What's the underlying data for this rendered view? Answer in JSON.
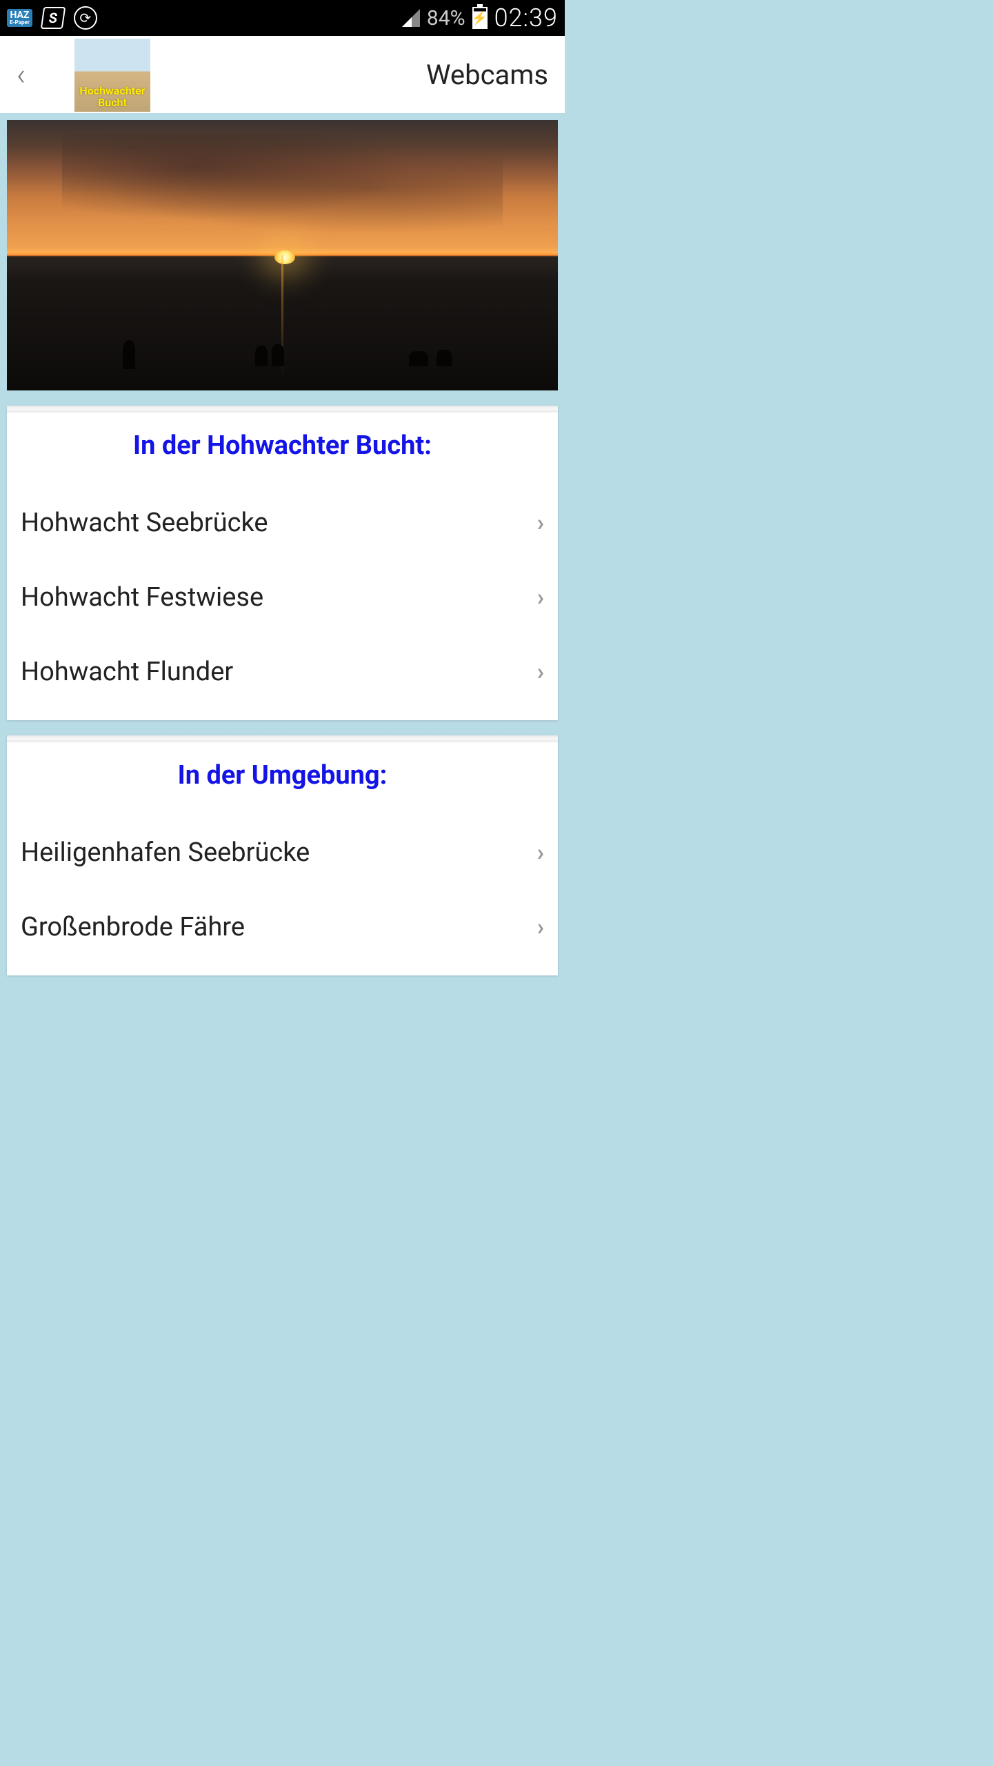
{
  "status": {
    "haz_label": "HAZ",
    "haz_sub": "E-Paper",
    "s_label": "S",
    "refresh_glyph": "⟳",
    "battery_pct": "84%",
    "bolt": "⚡",
    "time": "02:39"
  },
  "header": {
    "back_glyph": "‹",
    "logo_line1": "Hochwachter",
    "logo_line2": "Bucht",
    "title": "Webcams"
  },
  "sections": [
    {
      "title": "In der Hohwachter Bucht:",
      "items": [
        {
          "label": "Hohwacht Seebrücke"
        },
        {
          "label": "Hohwacht Festwiese"
        },
        {
          "label": "Hohwacht Flunder"
        }
      ]
    },
    {
      "title": "In der Umgebung:",
      "items": [
        {
          "label": "Heiligenhafen Seebrücke"
        },
        {
          "label": "Großenbrode Fähre"
        }
      ]
    }
  ],
  "chevron": "›"
}
